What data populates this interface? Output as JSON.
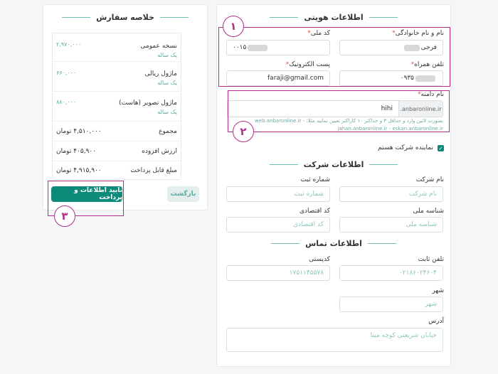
{
  "order_summary": {
    "title": "خلاصه سفارش",
    "items": [
      {
        "name": "نسخه عمومی",
        "period": "یک ساله",
        "price": "۲,۹۷۰,۰۰۰"
      },
      {
        "name": "ماژول ریالی",
        "period": "یک ساله",
        "price": "۶۶۰,۰۰۰"
      },
      {
        "name": "ماژول تصویر (هاست)",
        "period": "یک ساله",
        "price": "۸۸۰,۰۰۰"
      }
    ],
    "totals": [
      {
        "label": "مجموع",
        "value": "۴,۵۱۰,۰۰۰ تومان"
      },
      {
        "label": "ارزش افزوده",
        "value": "۴۰۵,۹۰۰ تومان"
      },
      {
        "label": "مبلغ قابل پرداخت",
        "value": "۴,۹۱۵,۹۰۰ تومان"
      }
    ],
    "confirm_label": "تایید اطلاعات و پرداخت",
    "back_label": "بازگشت"
  },
  "identity": {
    "title": "اطلاعات هویتی",
    "name_label": "نام و نام خانوادگی",
    "name_value": "فرجی",
    "national_code_label": "کد ملی",
    "national_code_value": "۰۰۱۵",
    "mobile_label": "تلفن همراه",
    "mobile_value": "۰۹۳۵",
    "email_label": "پست الکترونیک",
    "email_value": "faraji@gmail.com",
    "required_mark": "*"
  },
  "domain": {
    "label": "نام دامنه",
    "suffix": ".anbaronline.ir",
    "value": "hihi",
    "hint": "بصورت لاتین وارد و حداقل ۳ و حداکثر ۱۰ کاراکتر تعیین نمایید مثلا: - web.anbaronline.ir",
    "hint2": "jahan.anbaronline.ir - eskan.anbaronline.ir",
    "rep_checkbox_label": "نماینده شرکت هستم"
  },
  "company": {
    "title": "اطلاعات شرکت",
    "company_name_label": "نام شرکت",
    "company_name_placeholder": "نام شرکت",
    "reg_no_label": "شماره ثبت",
    "reg_no_placeholder": "شماره ثبت",
    "national_id_label": "شناسه ملی",
    "national_id_placeholder": "شناسه ملی",
    "eco_code_label": "کد اقتصادی",
    "eco_code_placeholder": "کد اقتصادی"
  },
  "contact": {
    "title": "اطلاعات تماس",
    "phone_label": "تلفن ثابت",
    "phone_placeholder": "۰۲۱۸۶۰۲۴۶۰۴",
    "postal_label": "کدپستی",
    "postal_placeholder": "۱۷۵۱۱۴۵۵۷۸",
    "city_label": "شهر",
    "city_placeholder": "شهر",
    "address_label": "آدرس",
    "address_placeholder": "خیابان شریعتی کوچه مینا"
  },
  "annotations": [
    "۱",
    "۲",
    "۳"
  ],
  "colors": {
    "accent": "#0e8a7b",
    "annotation": "#b0308a",
    "placeholder": "#8cc7bf"
  }
}
